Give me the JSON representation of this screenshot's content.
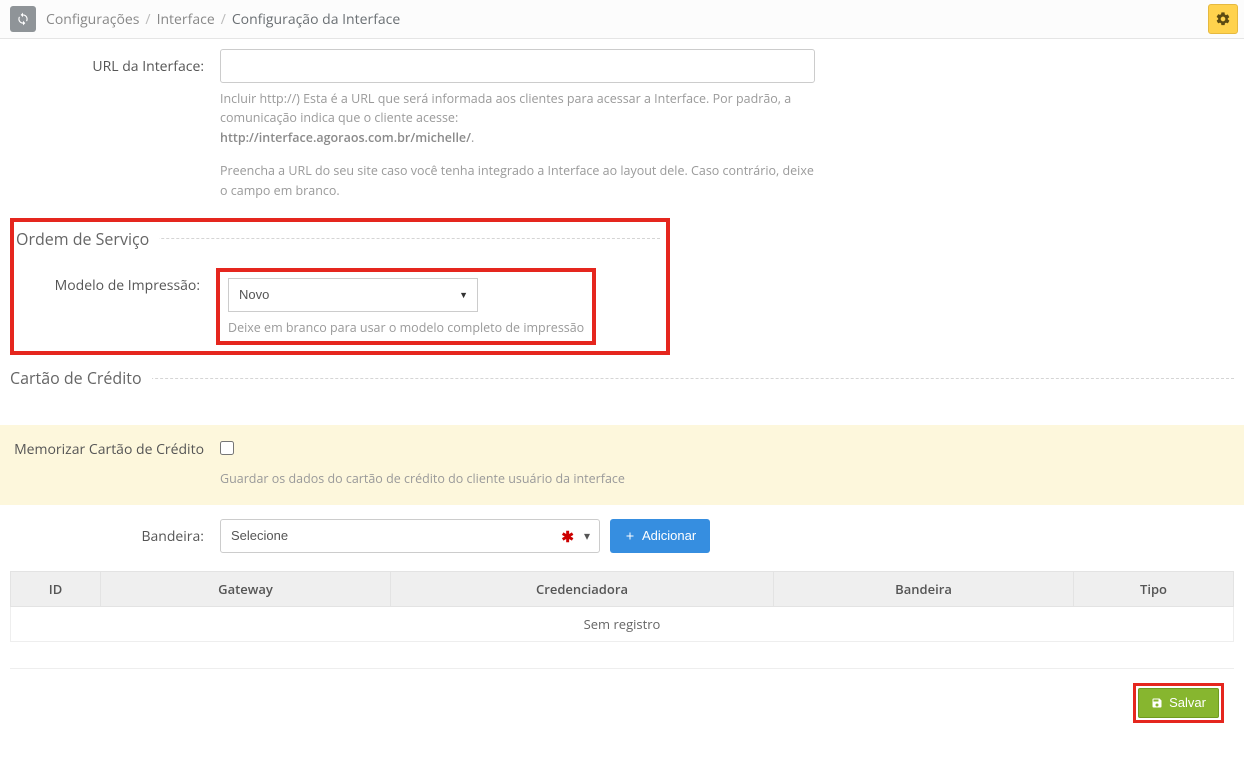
{
  "breadcrumb": {
    "item1": "Configurações",
    "item2": "Interface",
    "item3": "Configuração da Interface"
  },
  "url_section": {
    "label": "URL da Interface:",
    "value": "",
    "help1": "Incluir http://) Esta é a URL que será informada aos clientes para acessar a Interface. Por padrão, a comunicação indica que o cliente acesse:",
    "help1b": "http://interface.agoraos.com.br/michelle/",
    "help2": "Preencha a URL do seu site caso você tenha integrado a Interface ao layout dele. Caso contrário, deixe o campo em branco."
  },
  "ordem_servico": {
    "legend": "Ordem de Serviço",
    "label": "Modelo de Impressão:",
    "selected": "Novo",
    "help": "Deixe em branco para usar o modelo completo de impressão"
  },
  "cartao": {
    "legend": "Cartão de Crédito",
    "mem_label": "Memorizar Cartão de Crédito",
    "mem_help": "Guardar os dados do cartão de crédito do cliente usuário da interface",
    "bandeira_label": "Bandeira:",
    "bandeira_selected": "Selecione",
    "add_label": "Adicionar"
  },
  "table": {
    "headers": {
      "id": "ID",
      "gateway": "Gateway",
      "cred": "Credenciadora",
      "bandeira": "Bandeira",
      "tipo": "Tipo"
    },
    "empty": "Sem registro"
  },
  "footer": {
    "save": "Salvar"
  }
}
